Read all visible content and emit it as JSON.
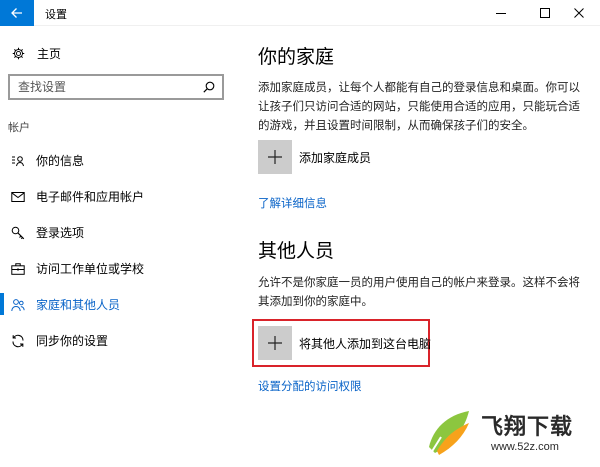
{
  "window": {
    "title": "设置"
  },
  "sidebar": {
    "home_label": "主页",
    "search_placeholder": "查找设置",
    "section_label": "帐户",
    "items": [
      {
        "label": "你的信息",
        "icon": "person-card-icon",
        "active": false
      },
      {
        "label": "电子邮件和应用帐户",
        "icon": "mail-icon",
        "active": false
      },
      {
        "label": "登录选项",
        "icon": "key-icon",
        "active": false
      },
      {
        "label": "访问工作单位或学校",
        "icon": "briefcase-icon",
        "active": false
      },
      {
        "label": "家庭和其他人员",
        "icon": "people-icon",
        "active": true
      },
      {
        "label": "同步你的设置",
        "icon": "sync-icon",
        "active": false
      }
    ]
  },
  "main": {
    "family": {
      "title": "你的家庭",
      "description": "添加家庭成员，让每个人都能有自己的登录信息和桌面。你可以让孩子们只访问合适的网站，只能使用合适的应用，只能玩合适的游戏，并且设置时间限制，从而确保孩子们的安全。",
      "add_label": "添加家庭成员",
      "link": "了解详细信息"
    },
    "others": {
      "title": "其他人员",
      "description": "允许不是你家庭一员的用户使用自己的帐户来登录。这样不会将其添加到你的家庭中。",
      "add_label": "将其他人添加到这台电脑",
      "link": "设置分配的访问权限"
    }
  },
  "watermark": {
    "name": "飞翔下载",
    "url": "www.52z.com"
  },
  "colors": {
    "accent": "#0078d7",
    "link": "#0a64c8",
    "highlight": "#d9232a"
  }
}
